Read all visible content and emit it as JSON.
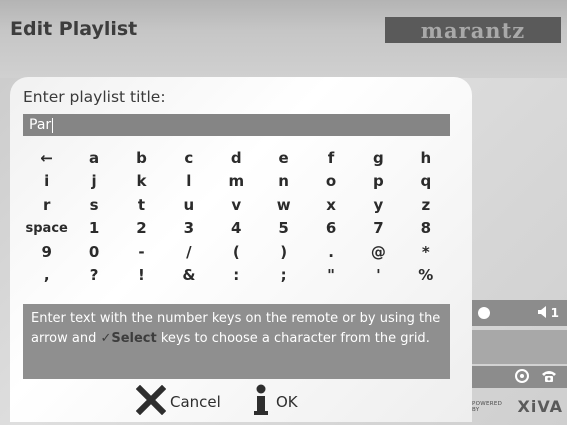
{
  "header": {
    "title": "Edit Playlist",
    "brand": "marantz"
  },
  "dialog": {
    "title": "Enter playlist title:",
    "input_value": "Par",
    "keys": [
      "←",
      "a",
      "b",
      "c",
      "d",
      "e",
      "f",
      "g",
      "h",
      "i",
      "j",
      "k",
      "l",
      "m",
      "n",
      "o",
      "p",
      "q",
      "r",
      "s",
      "t",
      "u",
      "v",
      "w",
      "x",
      "y",
      "z",
      "space",
      "1",
      "2",
      "3",
      "4",
      "5",
      "6",
      "7",
      "8",
      "9",
      "0",
      "-",
      "/",
      "(",
      ")",
      ".",
      "@",
      "*",
      ",",
      "?",
      "!",
      "&",
      ":",
      ";",
      "\"",
      "'",
      "%"
    ],
    "help_text_start": "Enter text with the number keys on the remote or by using the arrow and ",
    "help_text_select": "✓Select",
    "help_text_end": " keys to choose a character from the grid.",
    "cancel_label": "Cancel",
    "ok_label": "OK"
  },
  "side_panel": {
    "volume_level": "1",
    "powered_by": "POWERED BY",
    "xiva": "XiVA"
  },
  "colors": {
    "header_bg": "#c4c4c4",
    "input_bg": "#858585",
    "help_bg": "#8f8f8f",
    "dialog_bg": "#ffffff"
  },
  "icons": {
    "backspace": "left-arrow-icon",
    "cancel": "x-icon",
    "ok": "info-i-icon",
    "volume": "speaker-icon",
    "disc": "disc-icon",
    "phone": "phone-icon"
  }
}
